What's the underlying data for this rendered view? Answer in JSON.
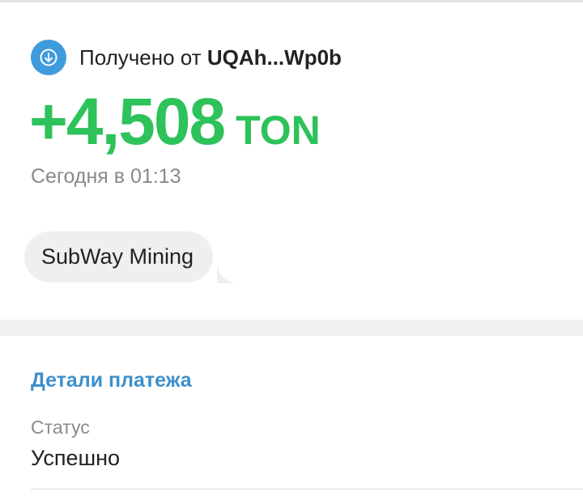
{
  "transaction": {
    "direction_icon": "arrow-down-circle-icon",
    "header_prefix": "Получено от",
    "header_address": "UQAh...Wp0b",
    "amount": "+4,508",
    "currency": "TON",
    "date": "Сегодня в 01:13",
    "comment": "SubWay Mining"
  },
  "details": {
    "title": "Детали платежа",
    "status_label": "Статус",
    "status_value": "Успешно"
  },
  "colors": {
    "amount_green": "#2dc25a",
    "accent_blue": "#3f8fcb",
    "icon_blue": "#3f9bdc",
    "secondary_text": "#8a8a8a"
  }
}
